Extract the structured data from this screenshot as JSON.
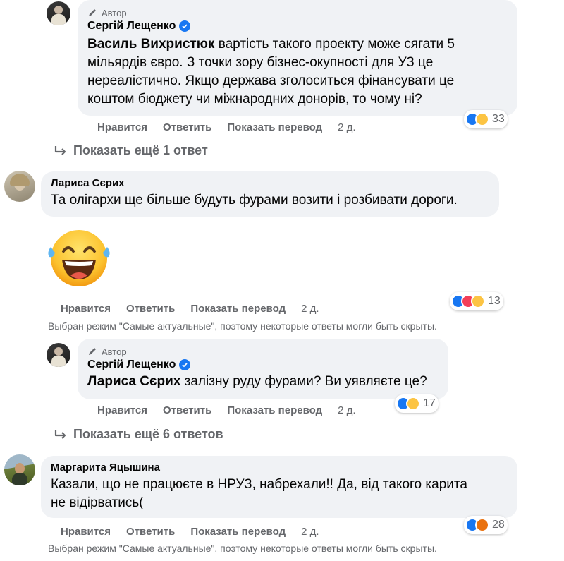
{
  "colors": {
    "bubble": "#f0f2f5",
    "muted": "#65676b",
    "like_blue": "#1877f2",
    "love_red": "#f33e58",
    "haha_yellow": "#fcc443",
    "angry_orange": "#e9710f"
  },
  "comments": [
    {
      "author_tag": "Автор",
      "author": "Сергій Лещенко",
      "mention": "Василь Вихристюк",
      "lines": [
        "вартість такого проекту може сягати 5",
        "мільярдів євро. З точки зору бізнес-окупності для УЗ це",
        "нереалістично. Якщо держава зголоситься фінансувати це",
        "коштом бюджету чи міжнародних донорів, то чому ні?"
      ],
      "actions": {
        "like": "Нравится",
        "reply": "Ответить",
        "translate": "Показать перевод",
        "time": "2 д."
      },
      "reactions": {
        "icons": [
          "like-icon",
          "haha-icon"
        ],
        "count": "33"
      }
    },
    {
      "author": "Лариса Сєрих",
      "text": "Та олігархи ще більше будуть фурами возити і розбивати дороги.",
      "sticker": "laughing-tears-emoji",
      "actions": {
        "like": "Нравится",
        "reply": "Ответить",
        "translate": "Показать перевод",
        "time": "2 д."
      },
      "reactions": {
        "icons": [
          "like-icon",
          "love-icon",
          "sad-icon"
        ],
        "count": "13"
      }
    },
    {
      "author_tag": "Автор",
      "author": "Сергій Лещенко",
      "mention": "Лариса Сєрих",
      "text": "залізну руду фурами? Ви уявляєте це?",
      "actions": {
        "like": "Нравится",
        "reply": "Ответить",
        "translate": "Показать перевод",
        "time": "2 д."
      },
      "reactions": {
        "icons": [
          "like-icon",
          "haha-icon"
        ],
        "count": "17"
      }
    },
    {
      "author": "Маргарита Яцышина",
      "lines": [
        "Казали, що не працюєте в НРУЗ, набрехали!! Да, від такого карита",
        "не відірватись("
      ],
      "actions": {
        "like": "Нравится",
        "reply": "Ответить",
        "translate": "Показать перевод",
        "time": "2 д."
      },
      "reactions": {
        "icons": [
          "like-icon",
          "angry-icon"
        ],
        "count": "28"
      }
    }
  ],
  "more_replies_1": "Показать ещё 1 ответ",
  "more_replies_6": "Показать ещё 6 ответов",
  "notice": "Выбран режим \"Самые актуальные\", поэтому некоторые ответы могли быть скрыты."
}
